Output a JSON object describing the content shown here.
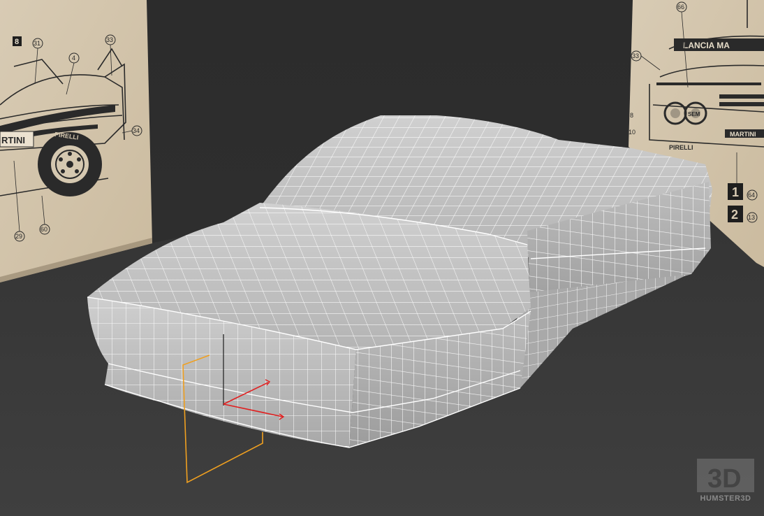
{
  "viewport": {
    "background_color": "#2e2e2e",
    "floor_color": "#3a3a3a",
    "mesh_fill": "#c4c4c4",
    "mesh_wire": "#ffffff",
    "gizmo_color": "#f0a020",
    "axis_color": "#e02020"
  },
  "left_blueprint": {
    "labels": [
      "8",
      "31",
      "4",
      "33",
      "34",
      "29",
      "60"
    ],
    "texts": {
      "martini": "RTINI",
      "pirelli": "PIRELLI"
    }
  },
  "right_blueprint": {
    "labels": [
      "66",
      "33",
      "8",
      "10",
      "64",
      "13"
    ],
    "badges": [
      "1",
      "2"
    ],
    "texts": {
      "windshield_banner": "LANCIA MA",
      "sem": "SEM",
      "pirelli": "PIRELLI",
      "martini": "MARTINI"
    }
  },
  "watermark": {
    "logo_text": "3D",
    "brand_text": "HUMSTER3D"
  }
}
